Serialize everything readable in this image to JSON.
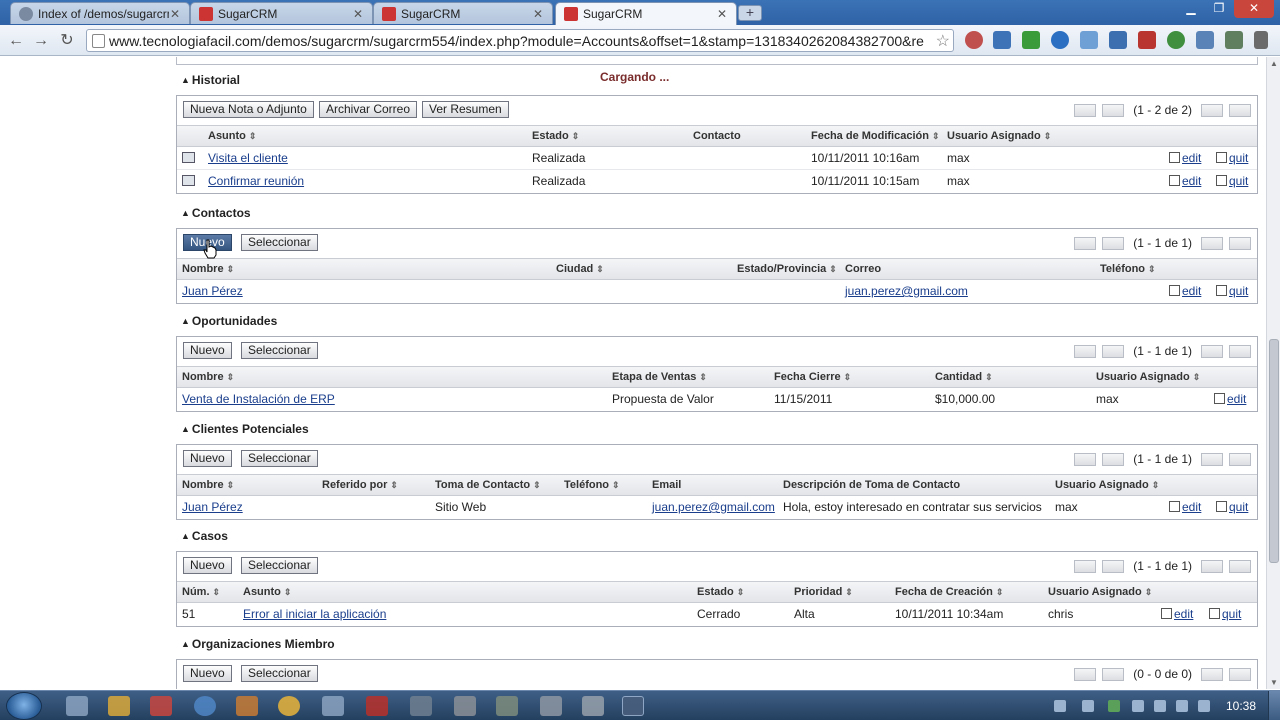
{
  "browser": {
    "tabs": [
      {
        "label": "Index of /demos/sugarcrm",
        "icon": "globe-icon"
      },
      {
        "label": "SugarCRM",
        "icon": "sugarcrm-cube-icon"
      },
      {
        "label": "SugarCRM",
        "icon": "sugarcrm-cube-icon"
      },
      {
        "label": "SugarCRM",
        "icon": "sugarcrm-cube-icon"
      }
    ],
    "url": "www.tecnologiafacil.com/demos/sugarcrm/sugarcrm554/index.php?module=Accounts&offset=1&stamp=1318340262084382700&re"
  },
  "loading_text": "Cargando ...",
  "historial": {
    "title": "Historial",
    "buttons": {
      "nueva_nota": "Nueva Nota o Adjunto",
      "archivar": "Archivar Correo",
      "ver_resumen": "Ver Resumen"
    },
    "pager": "(1 - 2 de 2)",
    "headers": {
      "asunto": "Asunto",
      "estado": "Estado",
      "contacto": "Contacto",
      "fecha": "Fecha de Modificación",
      "usuario": "Usuario Asignado"
    },
    "rows": [
      {
        "asunto": "Visita el cliente",
        "estado": "Realizada",
        "contacto": "",
        "fecha": "10/11/2011 10:16am",
        "usuario": "max"
      },
      {
        "asunto": "Confirmar reunión",
        "estado": "Realizada",
        "contacto": "",
        "fecha": "10/11/2011 10:15am",
        "usuario": "max"
      }
    ]
  },
  "actions": {
    "edit": "edit",
    "quit": "quit"
  },
  "contactos": {
    "title": "Contactos",
    "buttons": {
      "nuevo": "Nuevo",
      "seleccionar": "Seleccionar"
    },
    "pager": "(1 - 1 de 1)",
    "headers": {
      "nombre": "Nombre",
      "ciudad": "Ciudad",
      "estado": "Estado/Provincia",
      "correo": "Correo",
      "telefono": "Teléfono"
    },
    "rows": [
      {
        "nombre": "Juan Pérez",
        "ciudad": "",
        "estado": "",
        "correo": "juan.perez@gmail.com",
        "telefono": ""
      }
    ]
  },
  "oportunidades": {
    "title": "Oportunidades",
    "buttons": {
      "nuevo": "Nuevo",
      "seleccionar": "Seleccionar"
    },
    "pager": "(1 - 1 de 1)",
    "headers": {
      "nombre": "Nombre",
      "etapa": "Etapa de Ventas",
      "fecha": "Fecha Cierre",
      "cantidad": "Cantidad",
      "usuario": "Usuario Asignado"
    },
    "rows": [
      {
        "nombre": "Venta de Instalación de ERP",
        "etapa": "Propuesta de Valor",
        "fecha": "11/15/2011",
        "cantidad": "$10,000.00",
        "usuario": "max"
      }
    ]
  },
  "clientes": {
    "title": "Clientes Potenciales",
    "buttons": {
      "nuevo": "Nuevo",
      "seleccionar": "Seleccionar"
    },
    "pager": "(1 - 1 de 1)",
    "headers": {
      "nombre": "Nombre",
      "referido": "Referido por",
      "toma": "Toma de Contacto",
      "telefono": "Teléfono",
      "email": "Email",
      "descripcion": "Descripción de Toma de Contacto",
      "usuario": "Usuario Asignado"
    },
    "rows": [
      {
        "nombre": "Juan Pérez",
        "referido": "",
        "toma": "Sitio Web",
        "telefono": "",
        "email": "juan.perez@gmail.com",
        "descripcion": "Hola, estoy interesado en contratar sus servicios",
        "usuario": "max"
      }
    ]
  },
  "casos": {
    "title": "Casos",
    "buttons": {
      "nuevo": "Nuevo",
      "seleccionar": "Seleccionar"
    },
    "pager": "(1 - 1 de 1)",
    "headers": {
      "num": "Núm.",
      "asunto": "Asunto",
      "estado": "Estado",
      "prioridad": "Prioridad",
      "fecha": "Fecha de Creación",
      "usuario": "Usuario Asignado"
    },
    "rows": [
      {
        "num": "51",
        "asunto": "Error al iniciar la aplicación",
        "estado": "Cerrado",
        "prioridad": "Alta",
        "fecha": "10/11/2011 10:34am",
        "usuario": "chris"
      }
    ]
  },
  "organizaciones": {
    "title": "Organizaciones Miembro",
    "buttons": {
      "nuevo": "Nuevo",
      "seleccionar": "Seleccionar"
    },
    "pager": "(0 - 0 de 0)"
  },
  "taskbar": {
    "clock": "10:38"
  },
  "colors": {
    "link": "#1a3e8c",
    "loading": "#7a2c2c",
    "titlebar": "#3b73b6"
  }
}
